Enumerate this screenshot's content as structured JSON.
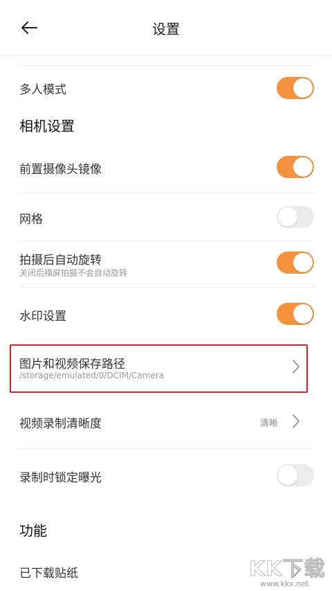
{
  "header": {
    "title": "设置",
    "back_icon": "arrow-left-icon"
  },
  "colors": {
    "accent": "#f6923d",
    "highlight": "#e02020"
  },
  "rows": {
    "multi_mode": {
      "label": "多人模式",
      "toggle": "on"
    },
    "front_mirror": {
      "label": "前置摄像头镜像",
      "toggle": "on"
    },
    "grid": {
      "label": "网格",
      "toggle": "off"
    },
    "auto_rotate": {
      "label": "拍摄后自动旋转",
      "sub": "关闭后横屏拍摄不会自动旋转",
      "toggle": "on"
    },
    "watermark": {
      "label": "水印设置",
      "toggle": "on"
    },
    "save_path": {
      "label": "图片和视频保存路径",
      "sub": "/storage/emulated/0/DCIM/Camera"
    },
    "video_quality": {
      "label": "视频录制清晰度",
      "value": "清晰"
    },
    "lock_exposure": {
      "label": "录制时锁定曝光",
      "toggle": "off"
    },
    "downloaded_stickers": {
      "label": "已下载贴纸"
    }
  },
  "sections": {
    "camera": "相机设置",
    "features": "功能"
  },
  "watermark_site": {
    "logo": "KK下载",
    "url": "www.kkx.net"
  }
}
